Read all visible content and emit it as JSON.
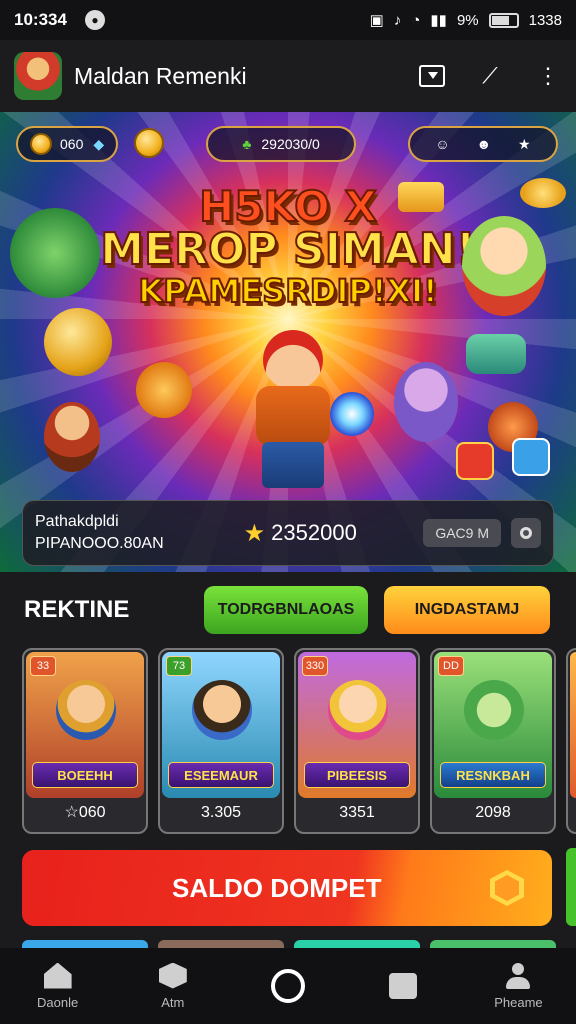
{
  "status_bar": {
    "time": "10:334",
    "battery_text": "9%",
    "clock_right": "1338",
    "battery_level": 0.7
  },
  "app_bar": {
    "title": "Maldan Remenki",
    "icons": [
      "cast-icon",
      "edit-icon",
      "more-icon"
    ]
  },
  "banner": {
    "coin_count": "060",
    "score": "292030/0",
    "headline_line1": "H5KO X",
    "headline_line2": "MEROP SIMAN!",
    "headline_line3": "KPAMESRDIP!XI!",
    "info_line1": "Pathakdpldi",
    "info_line2": "PIPANOOO.80AN",
    "stars": "2352000",
    "game_button": "GAC9 M"
  },
  "section": {
    "title": "REKTINE",
    "button_green": "TODRGBNLAOAS",
    "button_orange": "INGDASTAMJ"
  },
  "tiles": [
    {
      "badge": "33",
      "name": "BOEEHH",
      "price": "☆060"
    },
    {
      "badge": "73",
      "name": "ESEEMAUR",
      "price": "3.305"
    },
    {
      "badge": "330",
      "name": "PIBEESIS",
      "price": "3351"
    },
    {
      "badge": "DD",
      "name": "RESNKBAH",
      "price": "2098"
    }
  ],
  "saldo_button": "SALDO DOMPET",
  "bottom_nav": [
    {
      "label": "Daonle",
      "icon": "home-icon"
    },
    {
      "label": "Atm",
      "icon": "hexagon-icon"
    },
    {
      "label": "",
      "icon": "circle-icon"
    },
    {
      "label": "",
      "icon": "square-icon"
    },
    {
      "label": "Pheame",
      "icon": "profile-icon"
    }
  ],
  "colors": {
    "accent_red": "#e8211c",
    "accent_orange": "#ff8c1a",
    "accent_green": "#3ca520",
    "star_gold": "#ffce2e"
  }
}
